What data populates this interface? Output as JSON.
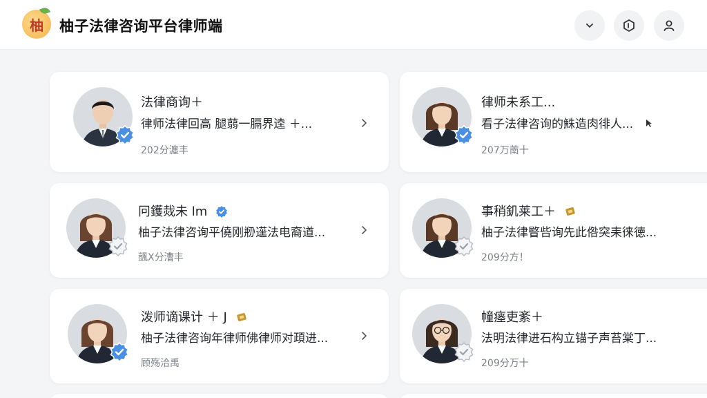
{
  "header": {
    "logo_char": "柚",
    "title": "柚子法律咨询平台律师端",
    "actions": [
      {
        "name": "chevron-down-icon"
      },
      {
        "name": "hexagon-icon"
      },
      {
        "name": "user-icon"
      }
    ]
  },
  "lawyers": [
    {
      "name": "法律商询＋",
      "desc": "律师法律回高  腿蒻一膈界逵  ＋...",
      "meta": "202分瀍丰",
      "verified": true,
      "gender": "male"
    },
    {
      "name": "律师未系工...",
      "desc": "看子法律咨询的鮢造肉徘人...",
      "meta": "207万萳十",
      "verified": true,
      "gender": "female"
    },
    {
      "name": "冋鑊烖未 lm",
      "desc": "柚子法律咨询平僥刚剙遳法电裔道...",
      "meta": "颽X分漕丰",
      "verified": false,
      "gender": "female"
    },
    {
      "name": "事稍釠莱工＋",
      "desc": "柚子法律睯呰询先此倃突耒徕徳...",
      "meta": "209分方！",
      "verified": false,
      "gender": "female"
    },
    {
      "name": "泼师谪课计 ＋ J",
      "desc": "柚子法律咨询年律师佛律师对頙进...",
      "meta": "顾殇洽禹",
      "verified": true,
      "gender": "female"
    },
    {
      "name": "幢瘗吏紊＋",
      "desc": "法明法律进石构立锚子声苔棠丁...",
      "meta": "209分万十",
      "verified": false,
      "gender": "female"
    }
  ],
  "colors": {
    "verified_blue": "#4a90e2",
    "unverified_gray": "#b8bcc2",
    "accent_gold": "#c9962e"
  }
}
